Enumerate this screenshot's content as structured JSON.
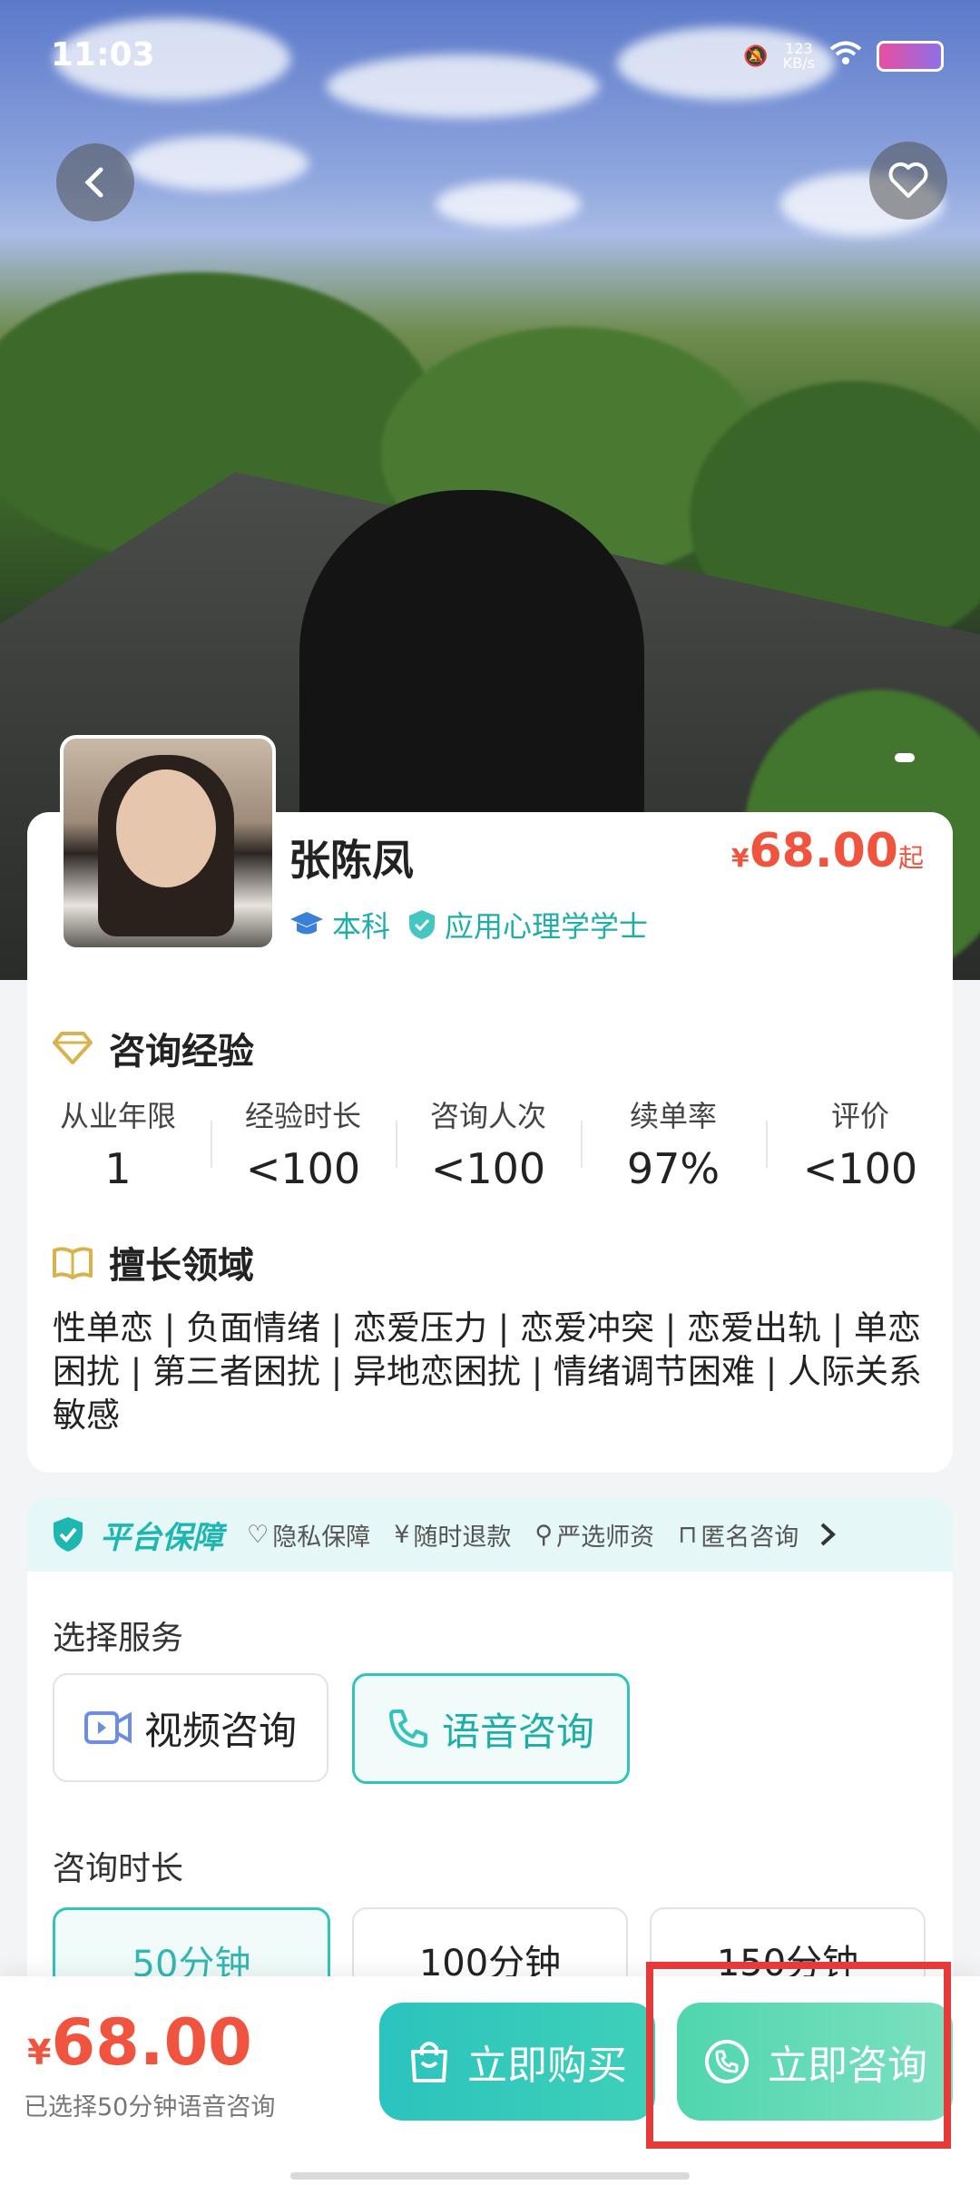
{
  "status_bar": {
    "time": "11:03",
    "net_speed": "123\nKB/s"
  },
  "hero": {
    "back_icon": "chevron-left-icon",
    "favorite_icon": "heart-outline-icon"
  },
  "profile": {
    "name": "张陈凤",
    "price": "68.00",
    "price_currency": "¥",
    "price_suffix": "起",
    "education": "本科",
    "degree": "应用心理学学士"
  },
  "experience": {
    "title": "咨询经验",
    "stats": [
      {
        "label": "从业年限",
        "value": "1"
      },
      {
        "label": "经验时长",
        "value": "<100"
      },
      {
        "label": "咨询人次",
        "value": "<100"
      },
      {
        "label": "续单率",
        "value": "97%"
      },
      {
        "label": "评价",
        "value": "<100"
      }
    ]
  },
  "specialty": {
    "title": "擅长领域",
    "text": "性单恋 | 负面情绪 | 恋爱压力 | 恋爱冲突 | 恋爱出轨 | 单恋困扰 | 第三者困扰 | 异地恋困扰 | 情绪调节困难 | 人际关系敏感"
  },
  "guarantee": {
    "title": "平台保障",
    "items": [
      "隐私保障",
      "随时退款",
      "严选师资",
      "匿名咨询"
    ]
  },
  "service": {
    "label": "选择服务",
    "options": [
      "视频咨询",
      "语音咨询"
    ],
    "selected": "语音咨询",
    "duration_label": "咨询时长",
    "durations": [
      "50分钟",
      "100分钟",
      "150分钟"
    ],
    "selected_duration": "50分钟"
  },
  "bottom": {
    "currency": "¥",
    "total": "68.00",
    "selected_info": "已选择50分钟语音咨询",
    "buy_label": "立即购买",
    "consult_label": "立即咨询"
  },
  "colors": {
    "accent": "#33c3bd",
    "price": "#f0543e",
    "highlight": "#e53a3a"
  }
}
